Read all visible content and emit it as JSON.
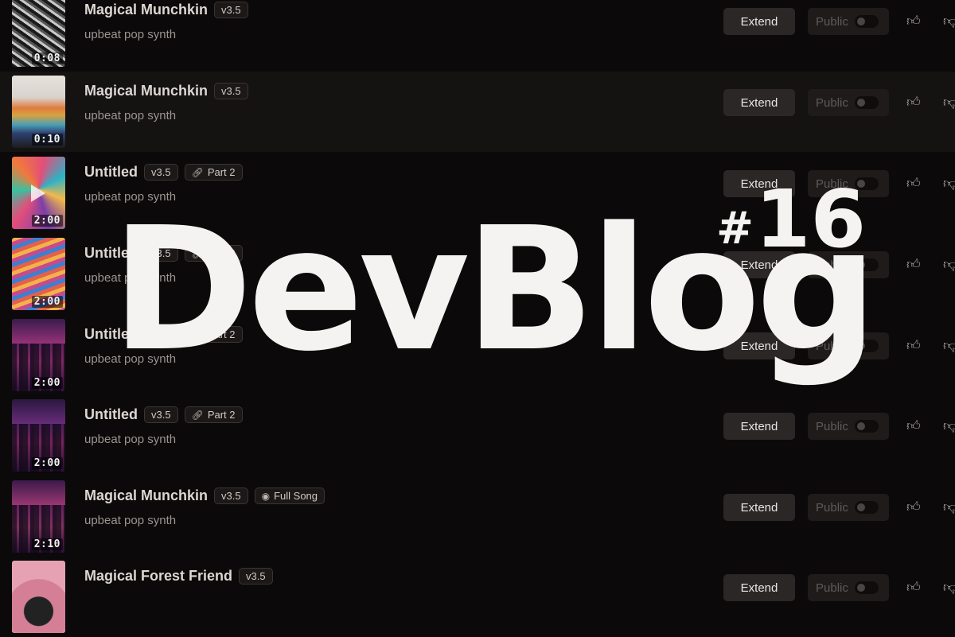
{
  "songs": [
    {
      "title": "Magical Munchkin",
      "version": "v3.5",
      "extra_badge": "",
      "extra_icon": "",
      "subtitle": "upbeat pop synth",
      "duration": "0:08",
      "extend_label": "Extend",
      "public_label": "Public",
      "highlighted": false,
      "art": "bw-texture"
    },
    {
      "title": "Magical Munchkin",
      "version": "v3.5",
      "extra_badge": "",
      "extra_icon": "",
      "subtitle": "upbeat pop synth",
      "duration": "0:10",
      "extend_label": "Extend",
      "public_label": "Public",
      "highlighted": true,
      "art": "mountain-landscape"
    },
    {
      "title": "Untitled",
      "version": "v3.5",
      "extra_badge": "Part 2",
      "extra_icon": "link-icon",
      "subtitle": "upbeat pop synth",
      "duration": "2:00",
      "extend_label": "Extend",
      "public_label": "Public",
      "highlighted": false,
      "art": "psychedelic-swirl",
      "play": true
    },
    {
      "title": "Untitled",
      "version": "v3.5",
      "extra_badge": "Part 2",
      "extra_icon": "link-icon",
      "subtitle": "upbeat pop synth",
      "duration": "2:00",
      "extend_label": "Extend",
      "public_label": "Public",
      "highlighted": false,
      "art": "rainbow-waves"
    },
    {
      "title": "Untitled",
      "version": "v3.5",
      "extra_badge": "Part 2",
      "extra_icon": "link-icon",
      "subtitle": "upbeat pop synth",
      "duration": "2:00",
      "extend_label": "Extend",
      "public_label": "Public",
      "highlighted": false,
      "art": "neon-city"
    },
    {
      "title": "Untitled",
      "version": "v3.5",
      "extra_badge": "Part 2",
      "extra_icon": "link-icon",
      "subtitle": "upbeat pop synth",
      "duration": "2:00",
      "extend_label": "Extend",
      "public_label": "Public",
      "highlighted": false,
      "art": "neon-city"
    },
    {
      "title": "Magical Munchkin",
      "version": "v3.5",
      "extra_badge": "Full Song",
      "extra_icon": "full-song-icon",
      "subtitle": "upbeat pop synth",
      "duration": "2:10",
      "extend_label": "Extend",
      "public_label": "Public",
      "highlighted": false,
      "art": "neon-city"
    },
    {
      "title": "Magical Forest Friend",
      "version": "v3.5",
      "extra_badge": "",
      "extra_icon": "",
      "subtitle": "",
      "duration": "",
      "extend_label": "Extend",
      "public_label": "Public",
      "highlighted": false,
      "art": "pink-vinyl"
    }
  ],
  "overlay": {
    "word": "DevBlog",
    "hash": "#",
    "number": "16"
  },
  "colors": {
    "background": "#0b0909",
    "button": "#2b2727",
    "overlay_text": "#f4f3f1"
  }
}
